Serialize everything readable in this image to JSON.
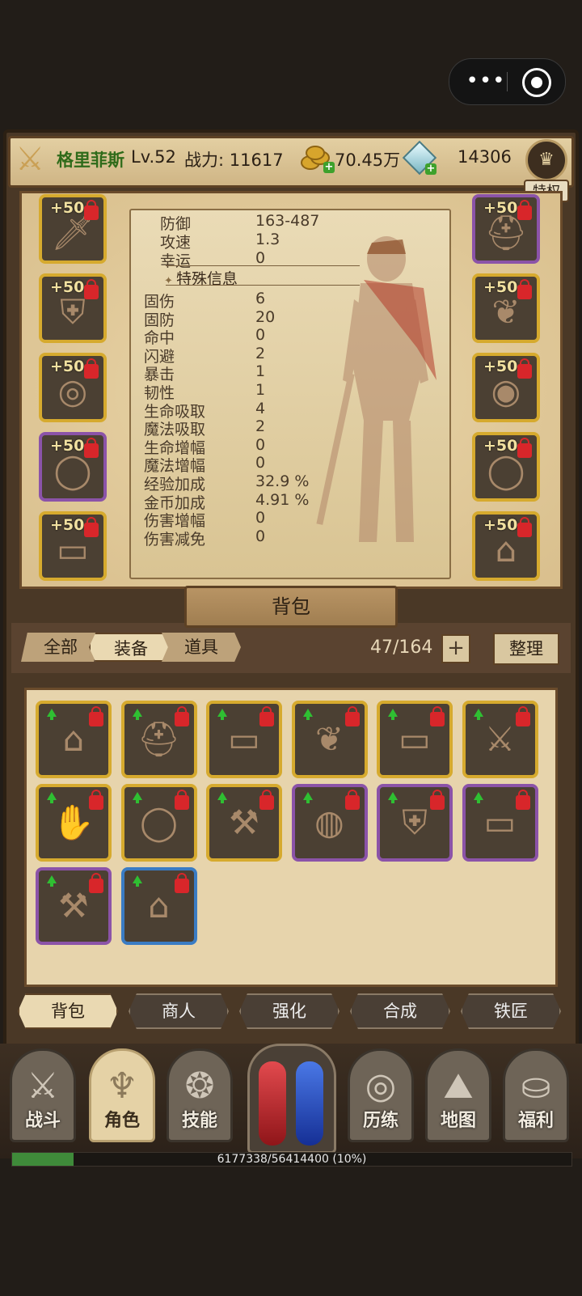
{
  "header": {
    "player_name": "格里菲斯",
    "level": "Lv.52",
    "power_label": "战力: 11617",
    "gold": "70.45万",
    "diamonds": "14306",
    "privilege": "特权"
  },
  "stats": [
    {
      "label": "防御",
      "value": "163-487"
    },
    {
      "label": "攻速",
      "value": "1.3"
    },
    {
      "label": "幸运",
      "value": "0"
    }
  ],
  "special_title": "特殊信息",
  "special_stats": [
    {
      "label": "固伤",
      "value": "6"
    },
    {
      "label": "固防",
      "value": "20"
    },
    {
      "label": "命中",
      "value": "0"
    },
    {
      "label": "闪避",
      "value": "2"
    },
    {
      "label": "暴击",
      "value": "1"
    },
    {
      "label": "韧性",
      "value": "1"
    },
    {
      "label": "生命吸取",
      "value": "4"
    },
    {
      "label": "魔法吸取",
      "value": "2"
    },
    {
      "label": "生命增幅",
      "value": "0"
    },
    {
      "label": "魔法增幅",
      "value": "0"
    },
    {
      "label": "经验加成",
      "value": "32.9 %"
    },
    {
      "label": "金币加成",
      "value": "4.91 %"
    },
    {
      "label": "伤害增幅",
      "value": "0"
    },
    {
      "label": "伤害减免",
      "value": "0"
    }
  ],
  "equip_left": [
    {
      "enh": "+50",
      "icon": "sword-icon",
      "rarity": "gold"
    },
    {
      "enh": "+50",
      "icon": "armor-icon",
      "rarity": "gold"
    },
    {
      "enh": "+50",
      "icon": "bracer-icon",
      "rarity": "gold"
    },
    {
      "enh": "+50",
      "icon": "ring-icon",
      "rarity": "purple"
    },
    {
      "enh": "+50",
      "icon": "belt-icon",
      "rarity": "gold"
    }
  ],
  "equip_right": [
    {
      "enh": "+50",
      "icon": "helmet-icon",
      "rarity": "purple"
    },
    {
      "enh": "+50",
      "icon": "necklace-icon",
      "rarity": "gold"
    },
    {
      "enh": "+50",
      "icon": "bracelet-icon",
      "rarity": "gold"
    },
    {
      "enh": "+50",
      "icon": "ring-icon",
      "rarity": "gold"
    },
    {
      "enh": "+50",
      "icon": "boots-icon",
      "rarity": "gold"
    }
  ],
  "bag": {
    "title": "背包",
    "tabs": [
      "全部",
      "装备",
      "道具"
    ],
    "active_tab": "装备",
    "count": "47/164",
    "add": "+",
    "sort": "整理",
    "items": [
      {
        "icon": "boots-icon",
        "rarity": "gold"
      },
      {
        "icon": "helmet-icon",
        "rarity": "gold"
      },
      {
        "icon": "belt-icon",
        "rarity": "gold"
      },
      {
        "icon": "necklace-icon",
        "rarity": "gold"
      },
      {
        "icon": "belt-icon",
        "rarity": "gold"
      },
      {
        "icon": "dagger-icon",
        "rarity": "gold"
      },
      {
        "icon": "gauntlet-icon",
        "rarity": "gold"
      },
      {
        "icon": "ring-icon",
        "rarity": "gold"
      },
      {
        "icon": "axe-icon",
        "rarity": "gold"
      },
      {
        "icon": "amulet-icon",
        "rarity": "purple"
      },
      {
        "icon": "armor-icon",
        "rarity": "purple"
      },
      {
        "icon": "belt-icon",
        "rarity": "purple"
      },
      {
        "icon": "axe-icon",
        "rarity": "purple"
      },
      {
        "icon": "boots-icon",
        "rarity": "blue"
      }
    ]
  },
  "actions": [
    "背包",
    "商人",
    "强化",
    "合成",
    "铁匠"
  ],
  "nav": [
    {
      "label": "战斗",
      "icon": "crossed-swords-icon"
    },
    {
      "label": "角色",
      "icon": "character-icon"
    },
    {
      "label": "技能",
      "icon": "skill-icon"
    },
    {
      "label": "历练",
      "icon": "vortex-icon"
    },
    {
      "label": "地图",
      "icon": "map-icon"
    },
    {
      "label": "福利",
      "icon": "chest-icon"
    }
  ],
  "xp": {
    "text": "6177338/56414400 (10%)",
    "fraction": 0.11
  },
  "colors": {
    "gold": "#d6aa2e",
    "purple": "#8b53a8",
    "blue": "#3a7cc4",
    "hp": "#c4262b",
    "mp": "#2455c9"
  }
}
